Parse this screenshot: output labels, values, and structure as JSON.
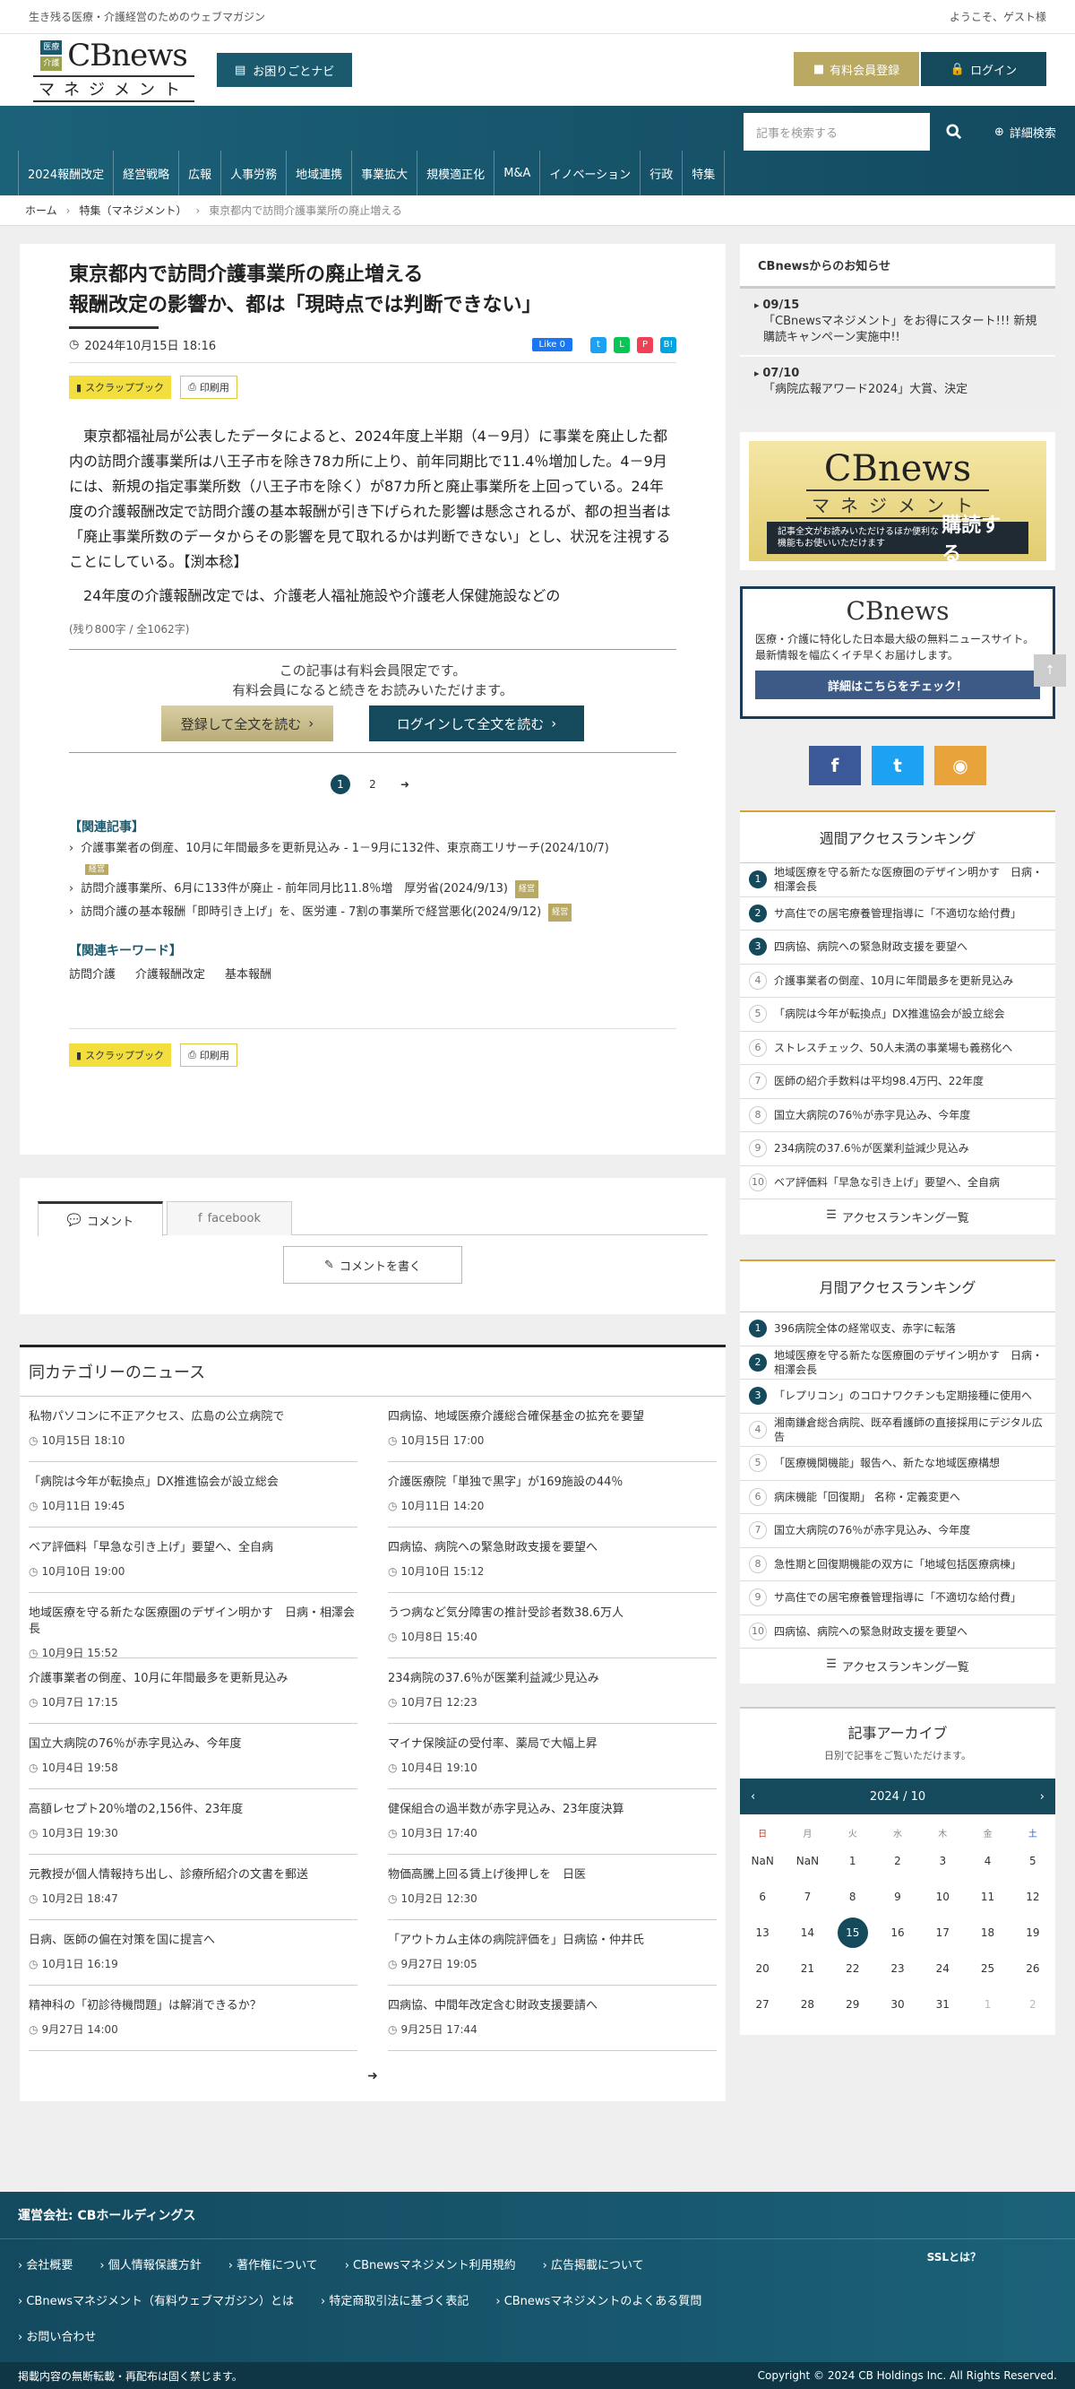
{
  "topbar": {
    "tagline": "生き残る医療・介護経営のためのウェブマガジン",
    "welcome": "ようこそ、ゲスト様"
  },
  "logo": {
    "tag1": "医療",
    "tag2": "介護",
    "name": "CBnews",
    "sub": "マネジメント"
  },
  "header": {
    "help": "お困りごとナビ",
    "register": "有料会員登録",
    "login": "ログイン"
  },
  "search": {
    "placeholder": "記事を検索する",
    "advanced": "詳細検索"
  },
  "nav": [
    "2024報酬改定",
    "経営戦略",
    "広報",
    "人事労務",
    "地域連携",
    "事業拡大",
    "規模適正化",
    "M&A",
    "イノベーション",
    "行政",
    "特集"
  ],
  "breadcrumb": {
    "home": "ホーム",
    "section": "特集（マネジメント）",
    "current": "東京都内で訪問介護事業所の廃止増える"
  },
  "article": {
    "title1": "東京都内で訪問介護事業所の廃止増える",
    "title2": "報酬改定の影響か、都は「現時点では判断できない」",
    "date": "2024年10月15日 18:16",
    "fb_like": "Like 0",
    "scrap": "スクラップブック",
    "print": "印刷用",
    "p1": "東京都福祉局が公表したデータによると、2024年度上半期（4－9月）に事業を廃止した都内の訪問介護事業所は八王子市を除き78カ所に上り、前年同期比で11.4％増加した。4－9月には、新規の指定事業所数（八王子市を除く）が87カ所と廃止事業所を上回っている。24年度の介護報酬改定で訪問介護の基本報酬が引き下げられた影響は懸念されるが、都の担当者は「廃止事業所数のデータからその影響を見て取れるかは判断できない」とし、状況を注視することにしている。【渕本稔】",
    "p2": "24年度の介護報酬改定では、介護老人福祉施設や介護老人保健施設などの",
    "remain": "(残り800字 / 全1062字)",
    "paywall1": "この記事は有料会員限定です。",
    "paywall2": "有料会員になると続きをお読みいただけます。",
    "btn_reg": "登録して全文を読む",
    "btn_login": "ログインして全文を読む",
    "pages": [
      "1",
      "2"
    ],
    "related_head": "【関連記事】",
    "related": [
      {
        "text": "介護事業者の倒産、10月に年間最多を更新見込み - 1－9月に132件、東京商工リサーチ(2024/10/7)",
        "badge": "経営"
      },
      {
        "text": "訪問介護事業所、6月に133件が廃止 - 前年同月比11.8％増　厚労省(2024/9/13)",
        "badge": "経営"
      },
      {
        "text": "訪問介護の基本報酬「即時引き上げ」を、医労連 - 7割の事業所で経営悪化(2024/9/12)",
        "badge": "経営"
      }
    ],
    "kw_head": "【関連キーワード】",
    "keywords": [
      "訪問介護",
      "介護報酬改定",
      "基本報酬"
    ]
  },
  "comments": {
    "tab1": "コメント",
    "tab2": "facebook",
    "write": "コメントを書く"
  },
  "news": {
    "head": "同カテゴリーのニュース",
    "left": [
      {
        "t": "私物パソコンに不正アクセス、広島の公立病院で",
        "d": "10月15日 18:10"
      },
      {
        "t": "「病院は今年が転換点」DX推進協会が設立総会",
        "d": "10月11日 19:45"
      },
      {
        "t": "ベア評価料「早急な引き上げ」要望へ、全自病",
        "d": "10月10日 19:00"
      },
      {
        "t": "地域医療を守る新たな医療圏のデザイン明かす　日病・相澤会長",
        "d": "10月9日 15:52"
      },
      {
        "t": "介護事業者の倒産、10月に年間最多を更新見込み",
        "d": "10月7日 17:15"
      },
      {
        "t": "国立大病院の76％が赤字見込み、今年度",
        "d": "10月4日 19:58"
      },
      {
        "t": "高額レセプト20％増の2,156件、23年度",
        "d": "10月3日 19:30"
      },
      {
        "t": "元教授が個人情報持ち出し、診療所紹介の文書を郵送",
        "d": "10月2日 18:47"
      },
      {
        "t": "日病、医師の偏在対策を国に提言へ",
        "d": "10月1日 16:19"
      },
      {
        "t": "精神科の「初診待機問題」は解消できるか？",
        "d": "9月27日 14:00"
      }
    ],
    "right": [
      {
        "t": "四病協、地域医療介護総合確保基金の拡充を要望",
        "d": "10月15日 17:00"
      },
      {
        "t": "介護医療院「単独で黒字」が169施設の44％",
        "d": "10月11日 14:20"
      },
      {
        "t": "四病協、病院への緊急財政支援を要望へ",
        "d": "10月10日 15:12"
      },
      {
        "t": "うつ病など気分障害の推計受診者数38.6万人",
        "d": "10月8日 15:40"
      },
      {
        "t": "234病院の37.6％が医業利益減少見込み",
        "d": "10月7日 12:23"
      },
      {
        "t": "マイナ保険証の受付率、薬局で大幅上昇",
        "d": "10月4日 19:10"
      },
      {
        "t": "健保組合の過半数が赤字見込み、23年度決算",
        "d": "10月3日 17:40"
      },
      {
        "t": "物価高騰上回る賃上げ後押しを　日医",
        "d": "10月2日 12:30"
      },
      {
        "t": "「アウトカム主体の病院評価を」日病協・仲井氏",
        "d": "9月27日 19:05"
      },
      {
        "t": "四病協、中間年改定含む財政支援要請へ",
        "d": "9月25日 17:44"
      }
    ]
  },
  "sidebar": {
    "notice_head": "CBnewsからのお知らせ",
    "notices": [
      {
        "date": "09/15",
        "text": "「CBnewsマネジメント」をお得にスタート!!! 新規購読キャンペーン実施中!!"
      },
      {
        "date": "07/10",
        "text": "「病院広報アワード2024」大賞、決定"
      }
    ],
    "banner1": {
      "small": "記事全文がお読みいただけるほか便利な機能もお使いいただけます",
      "big": "購読する"
    },
    "banner2": {
      "text": "医療・介護に特化した日本最大級の無料ニュースサイト。最新情報を幅広くイチ早くお届けします。",
      "btn": "詳細はこちらをチェック！"
    },
    "weekly_head": "週間アクセスランキング",
    "weekly": [
      "地域医療を守る新たな医療圏のデザイン明かす　日病・相澤会長",
      "サ高住での居宅療養管理指導に「不適切な給付費」",
      "四病協、病院への緊急財政支援を要望へ",
      "介護事業者の倒産、10月に年間最多を更新見込み",
      "「病院は今年が転換点」DX推進協会が設立総会",
      "ストレスチェック、50人未満の事業場も義務化へ",
      "医師の紹介手数料は平均98.4万円、22年度",
      "国立大病院の76％が赤字見込み、今年度",
      "234病院の37.6％が医業利益減少見込み",
      "ベア評価料「早急な引き上げ」要望へ、全自病"
    ],
    "monthly_head": "月間アクセスランキング",
    "monthly": [
      "396病院全体の経常収支、赤字に転落",
      "地域医療を守る新たな医療圏のデザイン明かす　日病・相澤会長",
      "「レプリコン」のコロナワクチンも定期接種に使用へ",
      "湘南鎌倉総合病院、既卒看護師の直接採用にデジタル広告",
      "「医療機関機能」報告へ、新たな地域医療構想",
      "病床機能「回復期」 名称・定義変更へ",
      "国立大病院の76％が赤字見込み、今年度",
      "急性期と回復期機能の双方に「地域包括医療病棟」",
      "サ高住での居宅療養管理指導に「不適切な給付費」",
      "四病協、病院への緊急財政支援を要望へ"
    ],
    "rank_more": "アクセスランキング一覧",
    "archive_head": "記事アーカイブ",
    "archive_sub": "日別で記事をご覧いただけます。",
    "cal_title": "2024 / 10",
    "dow": [
      "日",
      "月",
      "火",
      "水",
      "木",
      "金",
      "土"
    ],
    "days": [
      "NaN",
      "NaN",
      "1",
      "2",
      "3",
      "4",
      "5",
      "6",
      "7",
      "8",
      "9",
      "10",
      "11",
      "12",
      "13",
      "14",
      "15",
      "16",
      "17",
      "18",
      "19",
      "20",
      "21",
      "22",
      "23",
      "24",
      "25",
      "26",
      "27",
      "28",
      "29",
      "30",
      "31",
      "1",
      "2"
    ]
  },
  "footer": {
    "company": "運営会社: CBホールディングス",
    "links": [
      "会社概要",
      "個人情報保護方針",
      "著作権について",
      "CBnewsマネジメント利用規約",
      "広告掲載について",
      "CBnewsマネジメント（有料ウェブマガジン）とは",
      "特定商取引法に基づく表記",
      "CBnewsマネジメントのよくある質問",
      "お問い合わせ"
    ],
    "ssl": "SSLとは？",
    "notice": "掲載内容の無断転載・再配布は固く禁じます。",
    "copyright": "Copyright © 2024 CB Holdings Inc. All Rights Reserved."
  },
  "colors": {
    "primary": "#144a5c",
    "gold": "#b9a962",
    "scrap": "#f2df3d"
  }
}
